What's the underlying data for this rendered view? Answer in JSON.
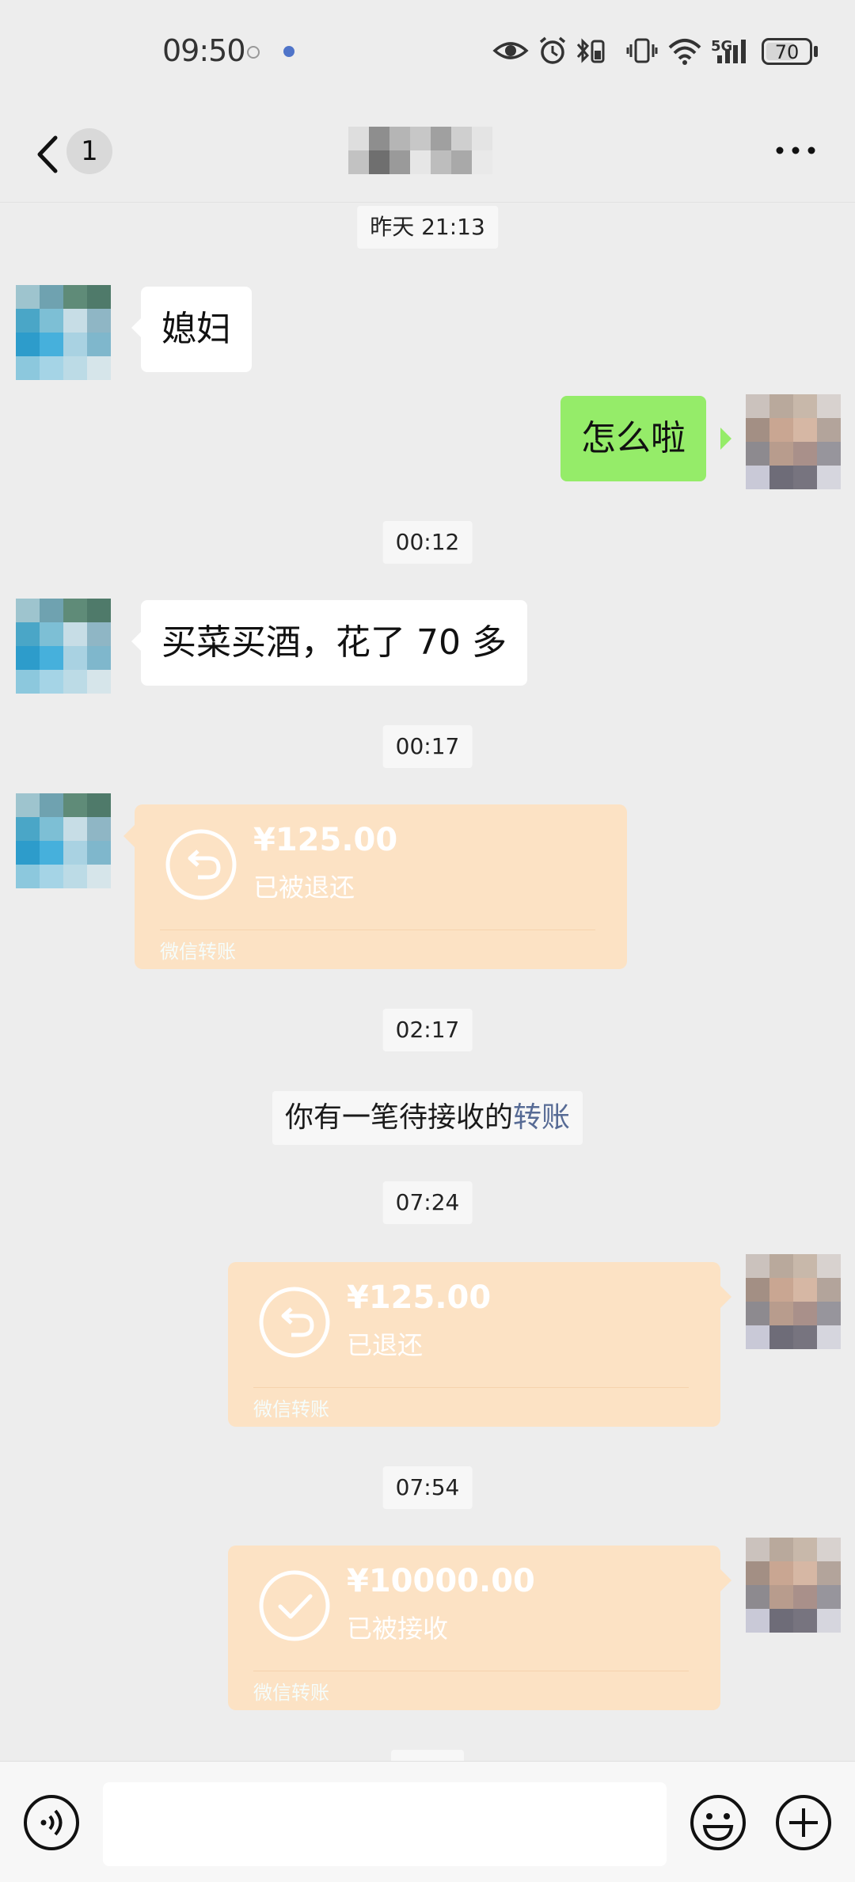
{
  "status_bar": {
    "time": "09:50",
    "network": "5G",
    "battery": "70",
    "battery_level": 70
  },
  "header": {
    "unread_count": "1",
    "contact_name_hidden": true
  },
  "messages": {
    "t1": "昨天 21:13",
    "m1": "媳妇",
    "m2": "怎么啦",
    "t2": "00:12",
    "m3": "买菜买酒，花了 70 多",
    "t3": "00:17",
    "tr1": {
      "amount": "¥125.00",
      "status": "已被退还",
      "label": "微信转账"
    },
    "t4": "02:17",
    "sys_text": "你有一笔待接收的",
    "sys_link": "转账",
    "t5": "07:24",
    "tr2": {
      "amount": "¥125.00",
      "status": "已退还",
      "label": "微信转账"
    },
    "t6": "07:54",
    "tr3": {
      "amount": "¥10000.00",
      "status": "已被接收",
      "label": "微信转账"
    }
  },
  "colors": {
    "accent_green": "#95ec69",
    "transfer_bg": "#fce2c4",
    "link": "#576b95"
  },
  "icons": [
    "back-icon",
    "more-icon",
    "voice-icon",
    "emoji-icon",
    "plus-icon",
    "refund-icon",
    "check-icon"
  ]
}
